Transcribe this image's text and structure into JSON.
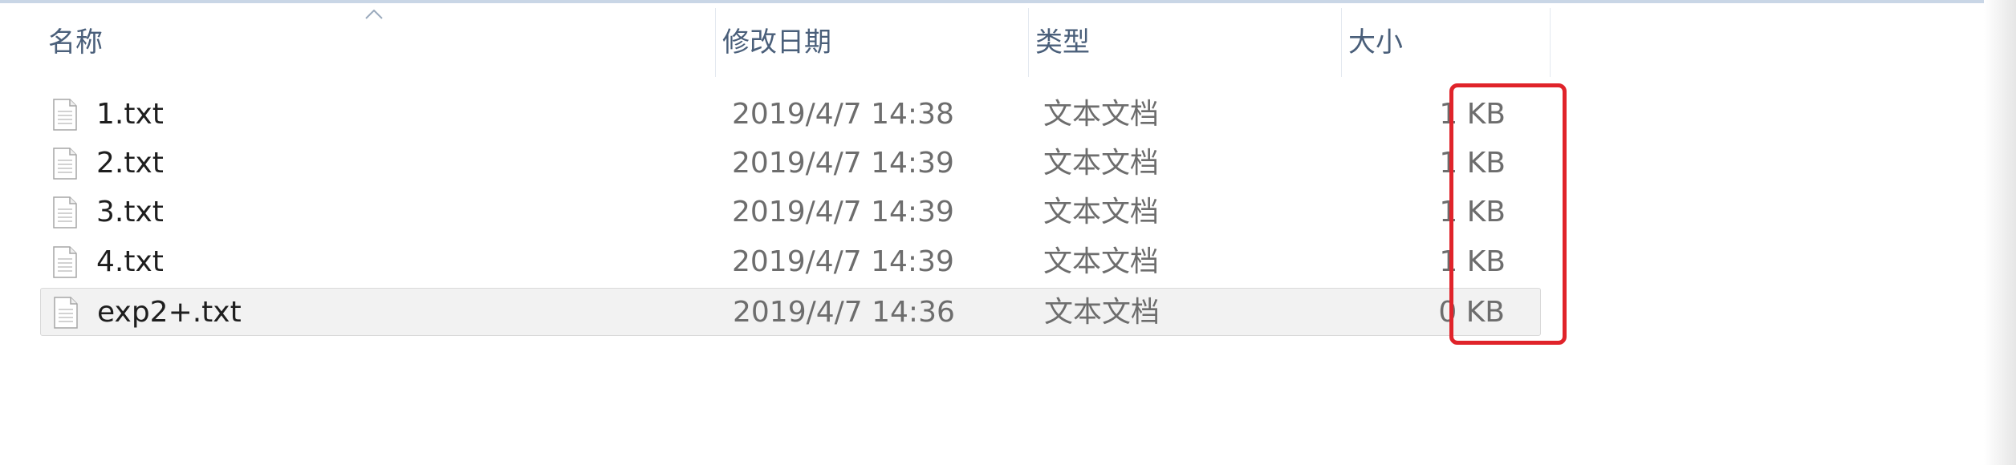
{
  "columns": {
    "name": "名称",
    "modified": "修改日期",
    "type": "类型",
    "size": "大小"
  },
  "files": [
    {
      "name": "1.txt",
      "modified": "2019/4/7 14:38",
      "type": "文本文档",
      "size": "1 KB",
      "icon": "text-file-icon"
    },
    {
      "name": "2.txt",
      "modified": "2019/4/7 14:39",
      "type": "文本文档",
      "size": "1 KB",
      "icon": "text-file-icon"
    },
    {
      "name": "3.txt",
      "modified": "2019/4/7 14:39",
      "type": "文本文档",
      "size": "1 KB",
      "icon": "text-file-icon"
    },
    {
      "name": "4.txt",
      "modified": "2019/4/7 14:39",
      "type": "文本文档",
      "size": "1 KB",
      "icon": "text-file-icon"
    },
    {
      "name": "exp2+.txt",
      "modified": "2019/4/7 14:36",
      "type": "文本文档",
      "size": "0 KB",
      "icon": "text-file-icon",
      "selected": true
    }
  ],
  "sort": {
    "column": "name",
    "direction": "ascending",
    "icon": "sort-up-icon"
  },
  "colors": {
    "header_text": "#4a5f7a",
    "highlight_box": "#e0232a",
    "selected_row": "#f2f2f2"
  }
}
